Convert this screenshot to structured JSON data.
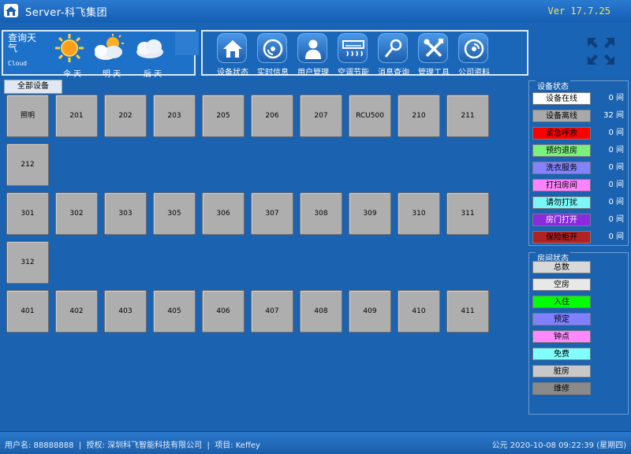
{
  "app": {
    "title": "Server-科飞集团",
    "version": "Ver 17.7.25"
  },
  "weather": {
    "label": "查询天气",
    "sub": "Cloud",
    "days": [
      {
        "label": "今 天",
        "icon": "sun-icon"
      },
      {
        "label": "明 天",
        "icon": "sun-cloud-icon"
      },
      {
        "label": "后 天",
        "icon": "cloud-icon"
      }
    ]
  },
  "nav": [
    {
      "label": "设备状态",
      "icon": "home-icon"
    },
    {
      "label": "实时信息",
      "icon": "disc-icon"
    },
    {
      "label": "用户管理",
      "icon": "user-icon"
    },
    {
      "label": "空调节能",
      "icon": "aircon-icon"
    },
    {
      "label": "消息查询",
      "icon": "magnifier-icon"
    },
    {
      "label": "管理工具",
      "icon": "tools-icon"
    },
    {
      "label": "公司资料",
      "icon": "company-disc-icon"
    }
  ],
  "panel": {
    "tab": "全部设备"
  },
  "rooms": [
    [
      "照明",
      "201",
      "202",
      "203",
      "205",
      "206",
      "207",
      "RCU500",
      "210",
      "211"
    ],
    [
      "212"
    ],
    [
      "301",
      "302",
      "303",
      "305",
      "306",
      "307",
      "308",
      "309",
      "310",
      "311"
    ],
    [
      "312"
    ],
    [
      "401",
      "402",
      "403",
      "405",
      "406",
      "407",
      "408",
      "409",
      "410",
      "411"
    ]
  ],
  "device_status": {
    "title": "设备状态",
    "items": [
      {
        "label": "设备在线",
        "count": "0 间",
        "bg": "#ffffff",
        "fg": "#000000"
      },
      {
        "label": "设备离线",
        "count": "32 间",
        "bg": "#a9a9a9",
        "fg": "#000000"
      },
      {
        "label": "紧急呼救",
        "count": "0 间",
        "bg": "#ff0000",
        "fg": "#000000"
      },
      {
        "label": "预约退房",
        "count": "0 间",
        "bg": "#7cf07c",
        "fg": "#000000"
      },
      {
        "label": "洗衣服务",
        "count": "0 间",
        "bg": "#8383ff",
        "fg": "#000000"
      },
      {
        "label": "打扫房间",
        "count": "0 间",
        "bg": "#ff82ff",
        "fg": "#000000"
      },
      {
        "label": "请勿打扰",
        "count": "0 间",
        "bg": "#7bf7f7",
        "fg": "#000000"
      },
      {
        "label": "房门打开",
        "count": "0 间",
        "bg": "#8a2be2",
        "fg": "#ffffff"
      },
      {
        "label": "保险柜开",
        "count": "0 间",
        "bg": "#b22222",
        "fg": "#000000"
      }
    ]
  },
  "room_status": {
    "title": "房间状态",
    "items": [
      {
        "label": "总数",
        "bg": "#d8d8d8",
        "fg": "#000000"
      },
      {
        "label": "空房",
        "bg": "#e8e8e8",
        "fg": "#000000"
      },
      {
        "label": "入住",
        "bg": "#00ff00",
        "fg": "#000000"
      },
      {
        "label": "预定",
        "bg": "#8080ff",
        "fg": "#000000"
      },
      {
        "label": "钟点",
        "bg": "#ff88ff",
        "fg": "#000000"
      },
      {
        "label": "免费",
        "bg": "#80ffff",
        "fg": "#000000"
      },
      {
        "label": "脏房",
        "bg": "#c8c8c8",
        "fg": "#000000"
      },
      {
        "label": "维修",
        "bg": "#8a8a8a",
        "fg": "#000000"
      }
    ]
  },
  "statusbar": {
    "user": "用户名: 88888888",
    "sep1": "|",
    "license": "授权: 深圳科飞智能科技有限公司",
    "sep2": "|",
    "project": "项目: Keffey",
    "datetime": "公元  2020-10-08  09:22:39 (星期四)"
  }
}
